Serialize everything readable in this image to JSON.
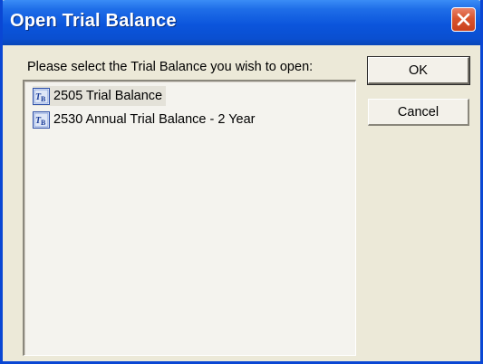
{
  "window": {
    "title": "Open Trial Balance",
    "close_icon": "close-icon"
  },
  "prompt": "Please select the Trial Balance you wish to open:",
  "list": {
    "items": [
      {
        "label": "2505 Trial Balance",
        "icon": "trial-balance-icon",
        "selected": true
      },
      {
        "label": "2530 Annual Trial Balance - 2 Year",
        "icon": "trial-balance-icon",
        "selected": false
      }
    ]
  },
  "buttons": {
    "ok_label": "OK",
    "cancel_label": "Cancel"
  },
  "colors": {
    "titlebar": "#0b55dc",
    "close_button": "#d9552e",
    "dialog_face": "#ece9d8"
  }
}
